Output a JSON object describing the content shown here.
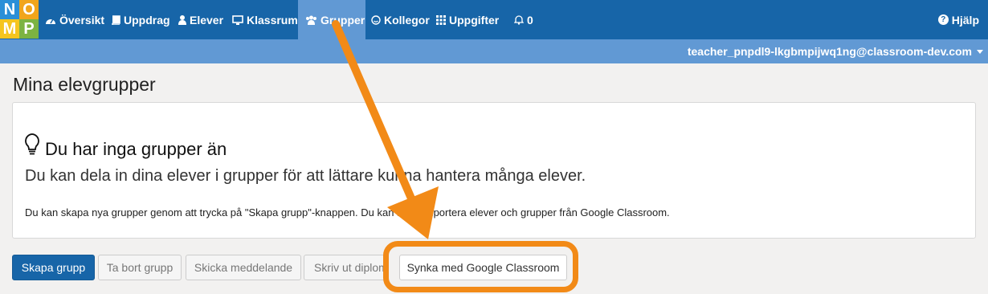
{
  "logo": {
    "letters": [
      "N",
      "O",
      "M",
      "P"
    ],
    "colors": [
      "#2a8fd8",
      "#f1a51c",
      "#f5c51e",
      "#7cb342"
    ]
  },
  "nav": {
    "items": [
      {
        "label": "Översikt",
        "icon": "dashboard-icon"
      },
      {
        "label": "Uppdrag",
        "icon": "book-icon"
      },
      {
        "label": "Elever",
        "icon": "user-icon"
      },
      {
        "label": "Klassrum",
        "icon": "monitor-icon"
      },
      {
        "label": "Grupper",
        "icon": "users-icon",
        "active": true
      },
      {
        "label": "Kollegor",
        "icon": "smiley-icon"
      },
      {
        "label": "Uppgifter",
        "icon": "grid-icon"
      },
      {
        "label": "0",
        "icon": "bell-icon"
      }
    ],
    "help": "Hjälp"
  },
  "user": {
    "email": "teacher_pnpdl9-lkgbmpijwq1ng@classroom-dev.com"
  },
  "page": {
    "title": "Mina elevgrupper"
  },
  "empty_state": {
    "title": "Du har inga grupper än",
    "lead": "Du kan dela in dina elever i grupper för att lättare kunna hantera många elever.",
    "text": "Du kan skapa nya grupper genom att trycka på \"Skapa grupp\"-knappen. Du kan även importera elever och grupper från Google Classroom."
  },
  "buttons": {
    "create": "Skapa grupp",
    "delete": "Ta bort grupp",
    "message": "Skicka meddelande",
    "print": "Skriv ut diplom",
    "sync": "Synka med Google Classroom"
  },
  "colors": {
    "nav": "#1765a8",
    "subbar": "#6199d4",
    "annotation": "#f28a17"
  }
}
